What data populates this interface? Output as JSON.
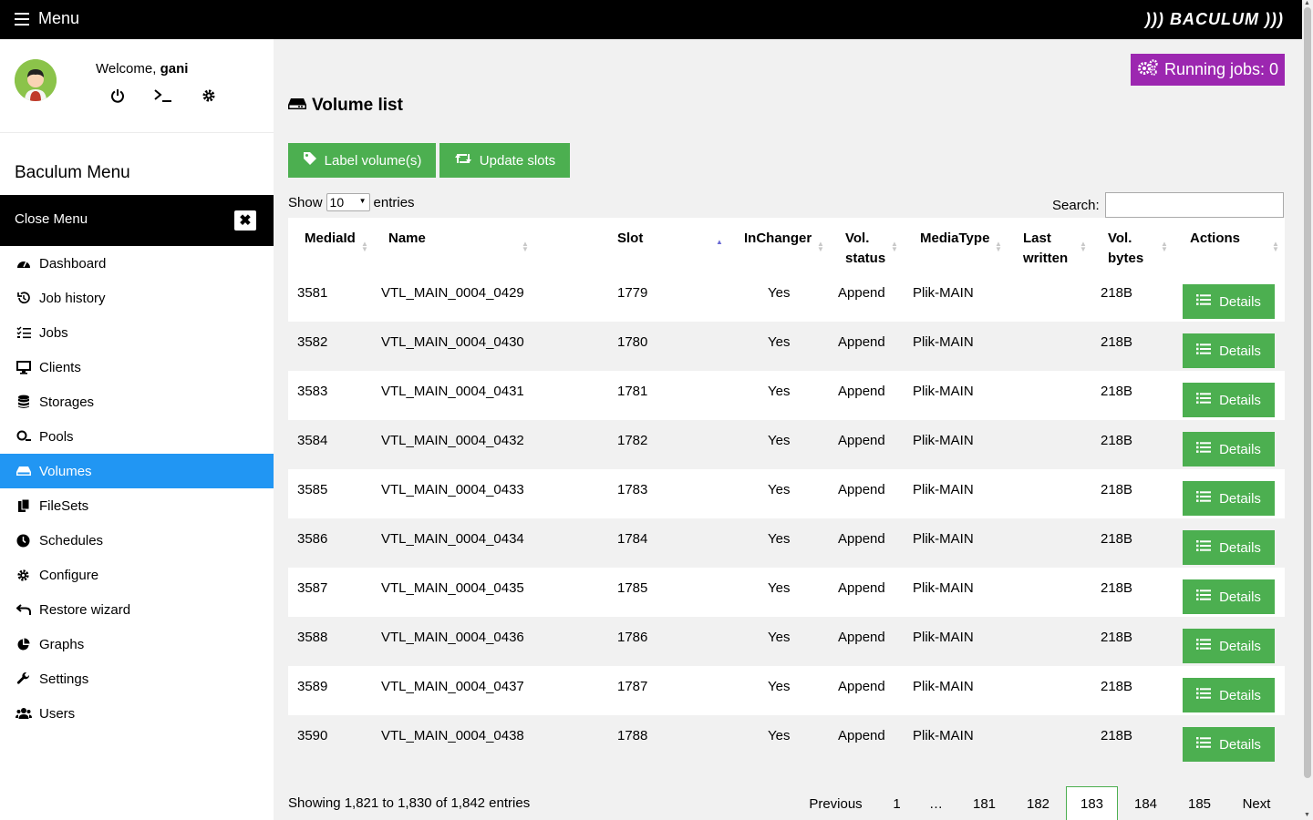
{
  "topbar": {
    "menu_label": "Menu",
    "brand": "))) BACULUM )))"
  },
  "user": {
    "welcome_prefix": "Welcome,",
    "username": "gani"
  },
  "sidebar": {
    "title": "Baculum Menu",
    "close_label": "Close Menu",
    "items": [
      {
        "label": "Dashboard",
        "icon": "dashboard-icon"
      },
      {
        "label": "Job history",
        "icon": "history-icon"
      },
      {
        "label": "Jobs",
        "icon": "tasks-icon"
      },
      {
        "label": "Clients",
        "icon": "desktop-icon"
      },
      {
        "label": "Storages",
        "icon": "database-icon"
      },
      {
        "label": "Pools",
        "icon": "pool-icon"
      },
      {
        "label": "Volumes",
        "icon": "hdd-icon"
      },
      {
        "label": "FileSets",
        "icon": "copy-icon"
      },
      {
        "label": "Schedules",
        "icon": "clock-icon"
      },
      {
        "label": "Configure",
        "icon": "gear-icon"
      },
      {
        "label": "Restore wizard",
        "icon": "undo-icon"
      },
      {
        "label": "Graphs",
        "icon": "pie-chart-icon"
      },
      {
        "label": "Settings",
        "icon": "wrench-icon"
      },
      {
        "label": "Users",
        "icon": "users-icon"
      }
    ],
    "active_index": 6
  },
  "main": {
    "running_jobs": "Running jobs: 0",
    "title": "Volume list",
    "label_btn": "Label volume(s)",
    "update_btn": "Update slots",
    "show_label": "Show",
    "entries_value": "10",
    "entries_label": "entries",
    "search_label": "Search:",
    "search_value": ""
  },
  "table": {
    "columns": [
      "MediaId",
      "Name",
      "Slot",
      "InChanger",
      "Vol. status",
      "MediaType",
      "Last written",
      "Vol. bytes",
      "Actions"
    ],
    "sorted_column": "Slot",
    "details_label": "Details",
    "rows": [
      [
        "3581",
        "VTL_MAIN_0004_0429",
        "1779",
        "Yes",
        "Append",
        "Plik-MAIN",
        "",
        "218B"
      ],
      [
        "3582",
        "VTL_MAIN_0004_0430",
        "1780",
        "Yes",
        "Append",
        "Plik-MAIN",
        "",
        "218B"
      ],
      [
        "3583",
        "VTL_MAIN_0004_0431",
        "1781",
        "Yes",
        "Append",
        "Plik-MAIN",
        "",
        "218B"
      ],
      [
        "3584",
        "VTL_MAIN_0004_0432",
        "1782",
        "Yes",
        "Append",
        "Plik-MAIN",
        "",
        "218B"
      ],
      [
        "3585",
        "VTL_MAIN_0004_0433",
        "1783",
        "Yes",
        "Append",
        "Plik-MAIN",
        "",
        "218B"
      ],
      [
        "3586",
        "VTL_MAIN_0004_0434",
        "1784",
        "Yes",
        "Append",
        "Plik-MAIN",
        "",
        "218B"
      ],
      [
        "3587",
        "VTL_MAIN_0004_0435",
        "1785",
        "Yes",
        "Append",
        "Plik-MAIN",
        "",
        "218B"
      ],
      [
        "3588",
        "VTL_MAIN_0004_0436",
        "1786",
        "Yes",
        "Append",
        "Plik-MAIN",
        "",
        "218B"
      ],
      [
        "3589",
        "VTL_MAIN_0004_0437",
        "1787",
        "Yes",
        "Append",
        "Plik-MAIN",
        "",
        "218B"
      ],
      [
        "3590",
        "VTL_MAIN_0004_0438",
        "1788",
        "Yes",
        "Append",
        "Plik-MAIN",
        "",
        "218B"
      ]
    ]
  },
  "footer": {
    "info": "Showing 1,821 to 1,830 of 1,842 entries",
    "pages": [
      "Previous",
      "1",
      "…",
      "181",
      "182",
      "183",
      "184",
      "185",
      "Next"
    ],
    "current_page": "183"
  },
  "colors": {
    "green": "#4caf50",
    "purple": "#9c27b0",
    "blue": "#2196f3"
  }
}
